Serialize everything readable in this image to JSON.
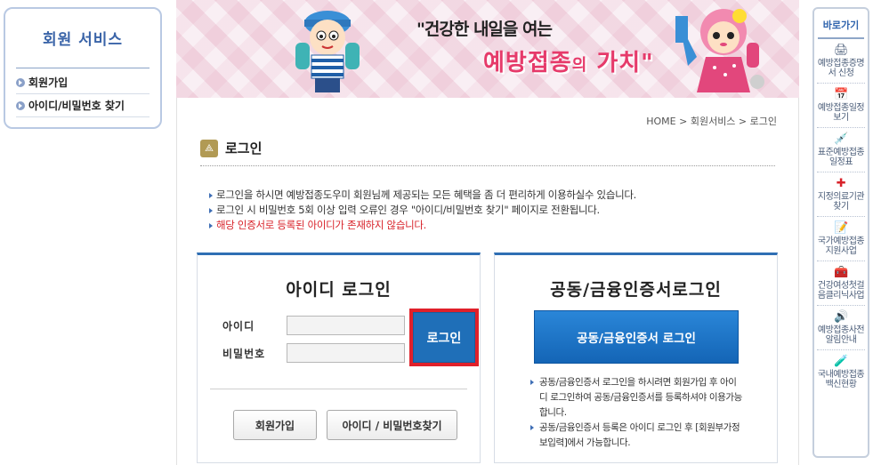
{
  "sidebar": {
    "title": "회원 서비스",
    "items": [
      {
        "label": "회원가입"
      },
      {
        "label": "아이디/비밀번호 찾기"
      }
    ]
  },
  "banner": {
    "slogan_line1": "\"건강한 내일을 여는",
    "slogan_main": "예방접종",
    "slogan_particle": "의",
    "slogan_end": "가치\""
  },
  "quick_links": {
    "title": "바로가기",
    "items": [
      {
        "label": "예방접종증명서 신청",
        "icon": "printer-icon"
      },
      {
        "label": "예방접종일정보기",
        "icon": "calendar-icon"
      },
      {
        "label": "표준예방접종일정표",
        "icon": "syringe-icon"
      },
      {
        "label": "지정의료기관찾기",
        "icon": "hospital-icon"
      },
      {
        "label": "국가예방접종지원사업",
        "icon": "document-icon"
      },
      {
        "label": "건강여성첫걸음클리닉사업",
        "icon": "clinic-icon"
      },
      {
        "label": "예방접종사전알림안내",
        "icon": "speaker-icon"
      },
      {
        "label": "국내예방접종백신현황",
        "icon": "vaccine-icon"
      }
    ]
  },
  "breadcrumb": "HOME > 회원서비스 > 로그인",
  "page_title": "로그인",
  "notices": [
    {
      "text": "로그인을 하시면 예방접종도우미 회원님께 제공되는 모든 혜택을 좀 더 편리하게 이용하실수 있습니다."
    },
    {
      "text": "로그인 시 비밀번호 5회 이상 입력 오류인 경우 \"아이디/비밀번호 찾기\" 페이지로 전환됩니다."
    },
    {
      "text": "해당 인증서로 등록된 아이디가 존재하지 않습니다."
    }
  ],
  "id_login": {
    "title": "아이디 로그인",
    "id_label": "아이디",
    "pw_label": "비밀번호",
    "id_value": "",
    "pw_value": "",
    "login_button": "로그인",
    "join_button": "회원가입",
    "find_button": "아이디 / 비밀번호찾기"
  },
  "cert_login": {
    "title": "공동/금융인증서로그인",
    "button": "공동/금융인증서 로그인",
    "notes": [
      "공동/금융인증서 로그인을 하시려면 회원가입 후 아이디 로그인하여 공동/금융인증서를 등록하셔야 이용가능합니다.",
      "공동/금융인증서 등록은 아이디 로그인 후 [회원부가정보입력]에서 가능합니다."
    ]
  },
  "colors": {
    "accent_blue": "#2f6fb4",
    "alert_red": "#d8222a",
    "highlight_border": "#e0202a"
  }
}
